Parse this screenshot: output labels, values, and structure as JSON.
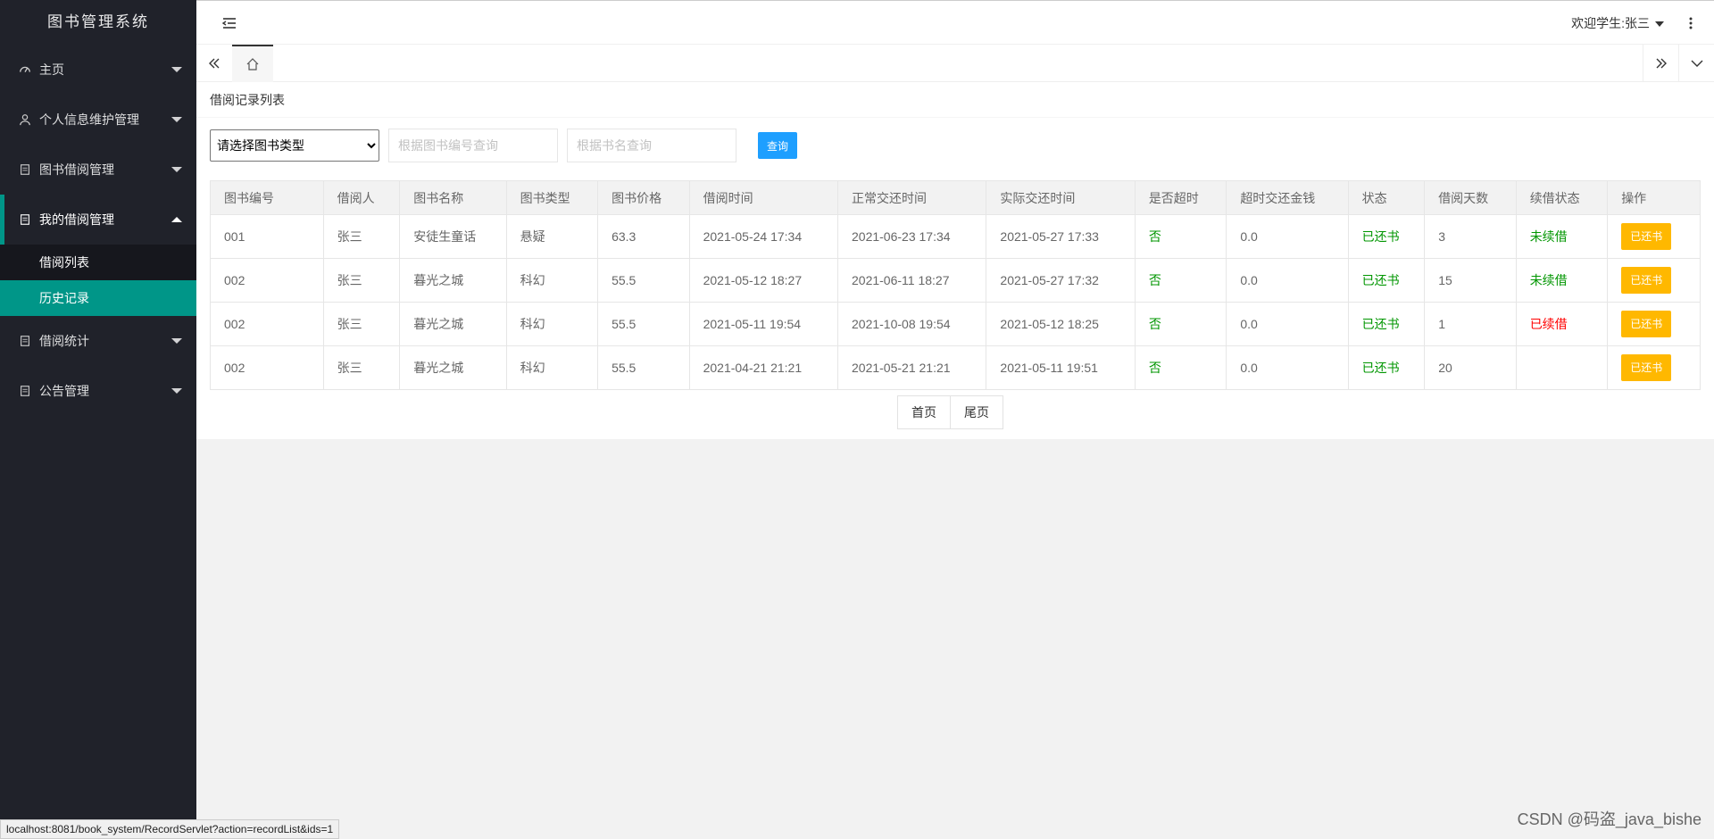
{
  "app": {
    "title": "图书管理系统"
  },
  "sidebar": {
    "items": [
      {
        "label": "主页",
        "icon": "dashboard-icon"
      },
      {
        "label": "个人信息维护管理",
        "icon": "user-icon"
      },
      {
        "label": "图书借阅管理",
        "icon": "list-icon"
      },
      {
        "label": "我的借阅管理",
        "icon": "list-icon",
        "open": true,
        "children": [
          {
            "label": "借阅列表"
          },
          {
            "label": "历史记录",
            "active": true
          }
        ]
      },
      {
        "label": "借阅统计",
        "icon": "list-icon"
      },
      {
        "label": "公告管理",
        "icon": "list-icon"
      }
    ]
  },
  "header": {
    "user_label": "欢迎学生:张三"
  },
  "card": {
    "title": "借阅记录列表"
  },
  "filter": {
    "select_value": "请选择图书类型",
    "code_placeholder": "根据图书编号查询",
    "name_placeholder": "根据书名查询",
    "query_label": "查询"
  },
  "table": {
    "headers": [
      "图书编号",
      "借阅人",
      "图书名称",
      "图书类型",
      "图书价格",
      "借阅时间",
      "正常交还时间",
      "实际交还时间",
      "是否超时",
      "超时交还金钱",
      "状态",
      "借阅天数",
      "续借状态",
      "操作"
    ],
    "rows": [
      [
        "001",
        "张三",
        "安徒生童话",
        "悬疑",
        "63.3",
        "2021-05-24 17:34",
        "2021-06-23 17:34",
        "2021-05-27 17:33",
        "否",
        "0.0",
        "已还书",
        "3",
        "未续借",
        "已还书"
      ],
      [
        "002",
        "张三",
        "暮光之城",
        "科幻",
        "55.5",
        "2021-05-12 18:27",
        "2021-06-11 18:27",
        "2021-05-27 17:32",
        "否",
        "0.0",
        "已还书",
        "15",
        "未续借",
        "已还书"
      ],
      [
        "002",
        "张三",
        "暮光之城",
        "科幻",
        "55.5",
        "2021-05-11 19:54",
        "2021-10-08 19:54",
        "2021-05-12 18:25",
        "否",
        "0.0",
        "已还书",
        "1",
        "已续借",
        "已还书"
      ],
      [
        "002",
        "张三",
        "暮光之城",
        "科幻",
        "55.5",
        "2021-04-21 21:21",
        "2021-05-21 21:21",
        "2021-05-11 19:51",
        "否",
        "0.0",
        "已还书",
        "20",
        "",
        "已还书"
      ]
    ]
  },
  "pager": {
    "first": "首页",
    "last": "尾页"
  },
  "status_url": "localhost:8081/book_system/RecordServlet?action=recordList&ids=1",
  "watermark": "CSDN @码盗_java_bishe",
  "colors": {
    "accent": "#009688",
    "query": "#1e9fff",
    "op": "#ffb800",
    "green": "#009600",
    "red": "#ff0000"
  }
}
